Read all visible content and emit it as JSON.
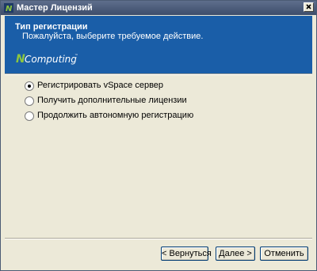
{
  "window": {
    "title": "Мастер Лицензий",
    "close_glyph": "✕"
  },
  "header": {
    "title": "Тип регистрации",
    "subtitle": "Пожалуйста, выберите требуемое действие.",
    "logo_text": "Computing",
    "logo_letter": "N",
    "logo_tm": "™",
    "accent_color": "#1a5ea8",
    "logo_green": "#8cc63f"
  },
  "options": [
    {
      "label": "Регистрировать vSpace сервер",
      "selected": true
    },
    {
      "label": "Получить дополнительные лицензии",
      "selected": false
    },
    {
      "label": "Продолжить автономную регистрацию",
      "selected": false
    }
  ],
  "buttons": {
    "back": "< Вернуться",
    "next": "Далее >",
    "cancel": "Отменить"
  }
}
